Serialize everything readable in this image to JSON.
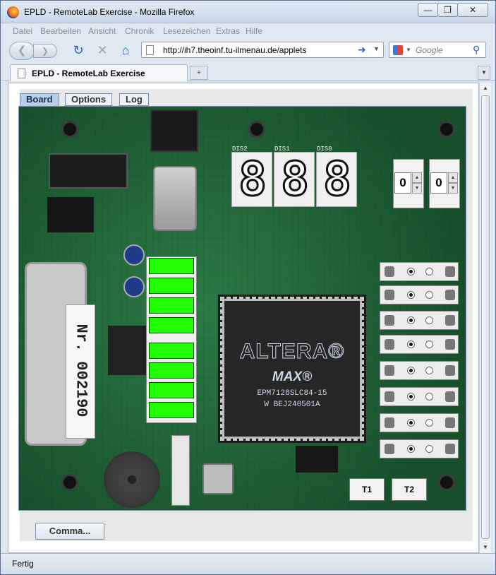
{
  "window": {
    "title": "EPLD - RemoteLab Exercise - Mozilla Firefox",
    "minimize": "—",
    "maximize": "❐",
    "close": "✕"
  },
  "menu": {
    "items": [
      "Datei",
      "Bearbeiten",
      "Ansicht",
      "Chronik",
      "Lesezeichen",
      "Extras",
      "Hilfe"
    ]
  },
  "navigation": {
    "url": "http://ih7.theoinf.tu-ilmenau.de/applets",
    "search_placeholder": "Google"
  },
  "tab": {
    "label": "EPLD - RemoteLab Exercise",
    "new_tab": "+"
  },
  "applet": {
    "tabs": [
      "Board",
      "Options",
      "Log"
    ],
    "active_tab": "Board",
    "displays": [
      {
        "label": "DIS2",
        "value": "8"
      },
      {
        "label": "DIS1",
        "value": "8"
      },
      {
        "label": "DIS0",
        "value": "8"
      }
    ],
    "spinners": [
      "0",
      "0"
    ],
    "leds": [
      true,
      true,
      true,
      true,
      true,
      true,
      true,
      true
    ],
    "switches": [
      true,
      true,
      true,
      true,
      true,
      true,
      true,
      true
    ],
    "buttons": [
      "T1",
      "T2"
    ],
    "chip": {
      "brand": "ALTERA®",
      "family": "MAX®",
      "part": "EPM7128SLC84-15",
      "code": "W BEJ240501A"
    },
    "board_label": "Nr. 002190",
    "command_button": "Comma..."
  },
  "status": {
    "text": "Fertig"
  },
  "colors": {
    "led_on": "#22ff00",
    "pcb_green": "#1e5e34",
    "active_tab": "#b8cfe8"
  }
}
